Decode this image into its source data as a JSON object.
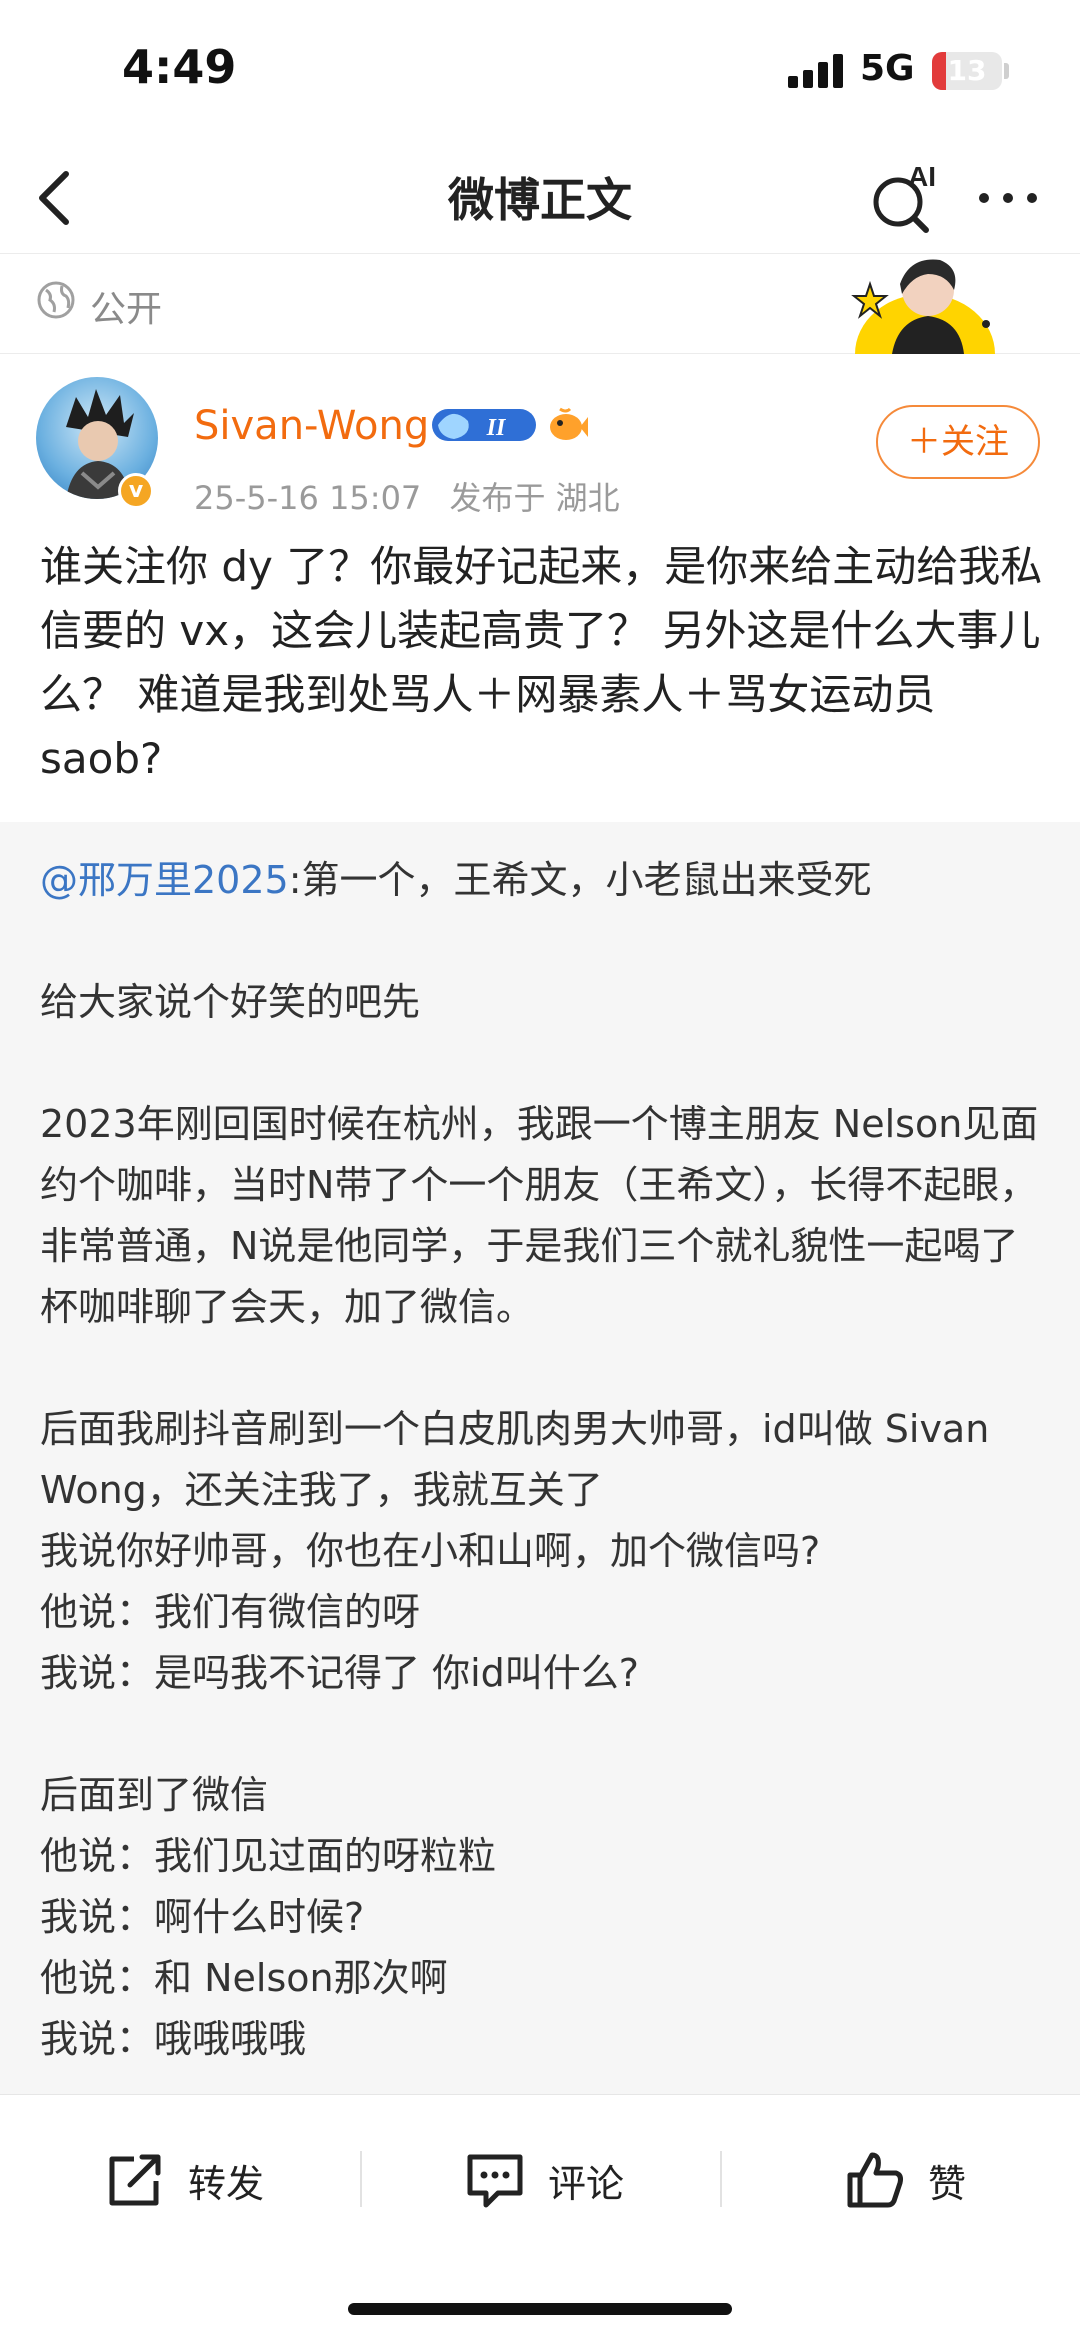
{
  "status_bar": {
    "time": "4:49",
    "network": "5G",
    "battery": "13"
  },
  "nav": {
    "title": "微博正文",
    "ai_label": "AI"
  },
  "visibility": {
    "label": "公开"
  },
  "post": {
    "username": "Sivan-Wong",
    "member_level": "II",
    "verify_mark": "v",
    "date": "25-5-16 15:07",
    "location": "发布于 湖北",
    "follow_label": "＋关注",
    "text": "谁关注你 dy 了？你最好记起来，是你来给主动给我私信要的 vx，这会儿装起高贵了？ 另外这是什么大事儿么？ 难道是我到处骂人＋网暴素人＋骂女运动员 saob?"
  },
  "repost": {
    "mention": "@邢万里2025",
    "first_line": ":第一个，王希文，小老鼠出来受死",
    "para1": "给大家说个好笑的吧先",
    "para2": "2023年刚回国时候在杭州，我跟一个博主朋友 Nelson见面约个咖啡，当时N带了个一个朋友（王希文），长得不起眼，非常普通，N说是他同学，于是我们三个就礼貌性一起喝了杯咖啡聊了会天，加了微信。",
    "para3_lines": [
      "后面我刷抖音刷到一个白皮肌肉男大帅哥，id叫做 Sivan Wong，还关注我了，我就互关了",
      "我说你好帅哥，你也在小和山啊，加个微信吗?",
      "他说：我们有微信的呀",
      "我说：是吗我不记得了 你id叫什么?"
    ],
    "para4_lines": [
      "后面到了微信",
      "他说：我们见过面的呀粒粒",
      "我说：啊什么时候?",
      "他说：和 Nelson那次啊",
      "我说：哦哦哦哦"
    ]
  },
  "actions": {
    "repost_label": "转发",
    "comment_label": "评论",
    "like_label": "赞"
  },
  "colors": {
    "accent_orange": "#f26b0f",
    "mention_blue": "#3b76c4",
    "repost_bg": "#f6f6f6"
  }
}
